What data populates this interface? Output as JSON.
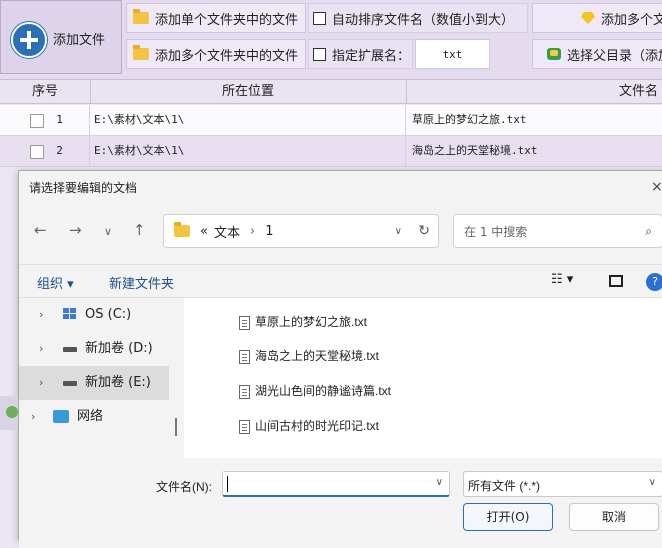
{
  "toolbar": {
    "add_file": "添加文件",
    "add_single_folder": "添加单个文件夹中的文件",
    "add_multi_folder": "添加多个文件夹中的文件",
    "auto_sort": "自动排序文件名（数值小到大）",
    "specify_ext": "指定扩展名：",
    "ext_value": "txt",
    "add_multi": "添加多个文",
    "select_parent": "选择父目录（添加"
  },
  "table": {
    "headers": {
      "index": "序号",
      "location": "所在位置",
      "filename": "文件名"
    },
    "rows": [
      {
        "index": "1",
        "location": "E:\\素材\\文本\\1\\",
        "filename": "草原上的梦幻之旅.txt"
      },
      {
        "index": "2",
        "location": "E:\\素材\\文本\\1\\",
        "filename": "海岛之上的天堂秘境.txt"
      }
    ]
  },
  "dialog": {
    "title": "请选择要编辑的文档",
    "close": "×",
    "address": {
      "prefix": "«",
      "crumb1": "文本",
      "sep": "›",
      "crumb2": "1"
    },
    "search_placeholder": "在 1 中搜索",
    "organize": "组织 ▾",
    "new_folder": "新建文件夹",
    "nav": [
      {
        "label": "OS (C:)"
      },
      {
        "label": "新加卷 (D:)"
      },
      {
        "label": "新加卷 (E:)"
      },
      {
        "label": "网络"
      }
    ],
    "files": [
      "草原上的梦幻之旅.txt",
      "海岛之上的天堂秘境.txt",
      "湖光山色间的静谧诗篇.txt",
      "山间古村的时光印记.txt"
    ],
    "filename_label": "文件名(N):",
    "filename_value": "",
    "filetype": "所有文件 (*.*)",
    "open": "打开(O)",
    "cancel": "取消"
  }
}
